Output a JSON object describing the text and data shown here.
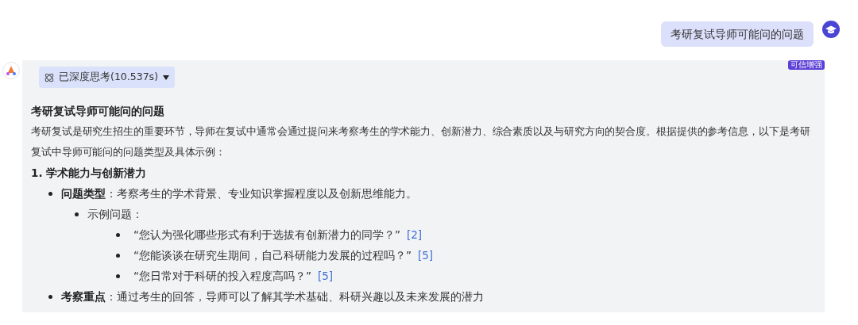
{
  "user_message": {
    "text": "考研复试导师可能问的问题"
  },
  "answer": {
    "badge": "可信增强",
    "thinking": {
      "label": "已深度思考(10.537s)",
      "expanded": false
    },
    "title": "考研复试导师可能问的问题",
    "intro": "考研复试是研究生招生的重要环节，导师在复试中通常会通过提问来考察考生的学术能力、创新潜力、综合素质以及与研究方向的契合度。根据提供的参考信息，以下是考研复试中导师可能问的问题类型及具体示例：",
    "sections": [
      {
        "heading": "1. 学术能力与创新潜力",
        "items": [
          {
            "label": "问题类型",
            "text": "：考察考生的学术背景、专业知识掌握程度以及创新思维能力。",
            "children": [
              {
                "text": "示例问题：",
                "children": [
                  {
                    "text": "“您认为强化哪些形式有利于选拔有创新潜力的同学？”",
                    "cite": "[2]"
                  },
                  {
                    "text": "“您能谈谈在研究生期间，自己科研能力发展的过程吗？”",
                    "cite": "[5]"
                  },
                  {
                    "text": "“您日常对于科研的投入程度高吗？”",
                    "cite": "[5]"
                  }
                ]
              }
            ]
          },
          {
            "label": "考察重点",
            "text": "：通过考生的回答，导师可以了解其学术基础、科研兴趣以及未来发展的潜力"
          }
        ]
      }
    ]
  }
}
